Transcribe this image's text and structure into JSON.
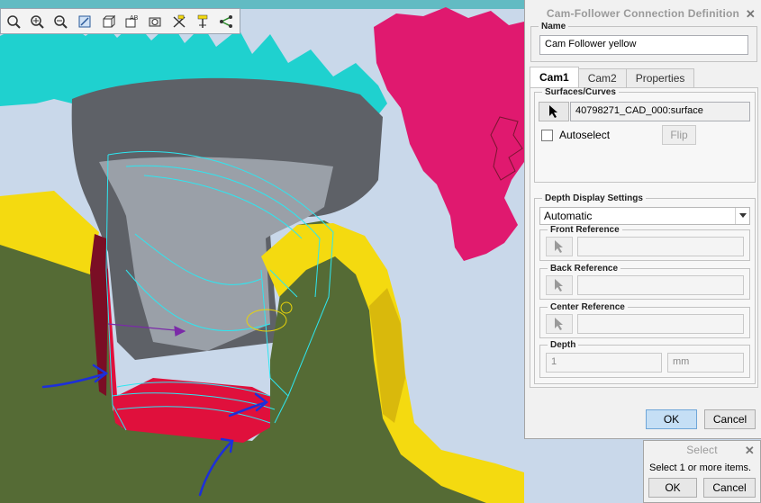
{
  "dialog": {
    "title": "Cam-Follower Connection Definition",
    "name_label": "Name",
    "name_value": "Cam Follower yellow",
    "tabs": [
      {
        "label": "Cam1",
        "active": true
      },
      {
        "label": "Cam2",
        "active": false
      },
      {
        "label": "Properties",
        "active": false
      }
    ],
    "surfaces_label": "Surfaces/Curves",
    "surface_value": "40798271_CAD_000:surface",
    "autoselect_label": "Autoselect",
    "autoselect_checked": false,
    "flip_label": "Flip",
    "depth_display_label": "Depth Display Settings",
    "depth_display_value": "Automatic",
    "front_reference_label": "Front Reference",
    "back_reference_label": "Back Reference",
    "center_reference_label": "Center Reference",
    "depth_label": "Depth",
    "depth_value": "1",
    "depth_unit": "mm",
    "ok_label": "OK",
    "cancel_label": "Cancel"
  },
  "select_dialog": {
    "title": "Select",
    "message": "Select 1 or more items.",
    "ok_label": "OK",
    "cancel_label": "Cancel"
  },
  "toolbar": {
    "icons": [
      "zoom-fit-icon",
      "zoom-in-icon",
      "zoom-out-icon",
      "repaint-icon",
      "view-orient-icon",
      "annotation-display-icon",
      "saved-views-icon",
      "datum-plane-display-icon",
      "datum-axis-display-icon",
      "datum-point-display-icon"
    ]
  },
  "colors": {
    "gear_cyan": "#1fd1cf",
    "gear_magenta": "#e0196f",
    "body_green": "#556b35",
    "follower_yellow": "#f4da10",
    "hub_gray": "#5e6167",
    "cam_red": "#e0103c",
    "arrow_blue": "#1d2fd9",
    "dialog_bg": "#f1f1f1",
    "ok_button": "#c5dff5"
  }
}
